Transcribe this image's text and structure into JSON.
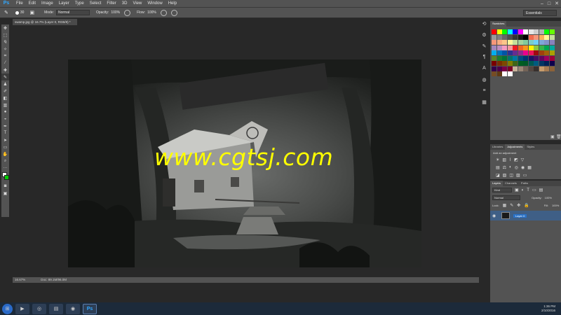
{
  "app": {
    "logo": "Ps"
  },
  "menubar": {
    "items": [
      "File",
      "Edit",
      "Image",
      "Layer",
      "Type",
      "Select",
      "Filter",
      "3D",
      "View",
      "Window",
      "Help"
    ]
  },
  "options_bar": {
    "brush_size": "30",
    "mode_label": "Mode:",
    "mode_value": "Normal",
    "opacity_label": "Opacity:",
    "opacity_value": "100%",
    "flow_label": "Flow:",
    "flow_value": "100%",
    "workspace": "Essentials"
  },
  "document": {
    "tab_title": "swamp.jpg @ 16.7% (Layer 0, RGB/8) *",
    "zoom": "16.67%",
    "doc_size": "Doc: 89.1M/96.0M"
  },
  "watermark": "www.cgtsj.com",
  "panels": {
    "swatches_title": "Swatches",
    "adjust_tabs": [
      "Libraries",
      "Adjustments",
      "Styles"
    ],
    "adjust_active": "Adjustments",
    "adjust_hint": "Add an adjustment",
    "layers_tabs": [
      "Layers",
      "Channels",
      "Paths"
    ],
    "layers_active": "Layers",
    "kind_label": "Kind",
    "blend_mode": "Normal",
    "opacity_label": "Opacity:",
    "opacity_value": "100%",
    "lock_label": "Lock:",
    "fill_label": "Fill:",
    "fill_value": "100%",
    "layer_name": "Layer 0"
  },
  "swatch_colors": [
    "#ff0000",
    "#ffff00",
    "#00ff00",
    "#00ffff",
    "#0000ff",
    "#ff00ff",
    "#ffffff",
    "#e6e6e6",
    "#cccccc",
    "#b3b3b3",
    "#00ff00",
    "#66ff00",
    "#999999",
    "#808080",
    "#666666",
    "#4d4d4d",
    "#333333",
    "#1a1a1a",
    "#000000",
    "#f26c4f",
    "#f69679",
    "#fbaf5d",
    "#fff799",
    "#c4df9b",
    "#f7977a",
    "#f9ad81",
    "#fdc68a",
    "#fff79a",
    "#c4df9b",
    "#a3d39c",
    "#82ca9d",
    "#7bcdc8",
    "#6ecff6",
    "#7ea7d8",
    "#8493ca",
    "#8882be",
    "#a187be",
    "#bc8dbf",
    "#f49ac2",
    "#f6989d",
    "#ed1c24",
    "#f26522",
    "#f7941d",
    "#fff200",
    "#8dc63f",
    "#39b54a",
    "#00a651",
    "#00a99d",
    "#00aeef",
    "#0072bc",
    "#0054a6",
    "#2e3192",
    "#662d91",
    "#92278f",
    "#ec008c",
    "#ed145b",
    "#9e0b0f",
    "#a0410d",
    "#a36209",
    "#aba000",
    "#598527",
    "#1a7b30",
    "#007236",
    "#00746b",
    "#0076a3",
    "#004b80",
    "#003471",
    "#1b1464",
    "#440e62",
    "#630460",
    "#9e005d",
    "#9e0039",
    "#790000",
    "#7b2e00",
    "#7d4900",
    "#827b00",
    "#406618",
    "#005e20",
    "#005826",
    "#005952",
    "#005b7f",
    "#003663",
    "#002157",
    "#0d004c",
    "#32004b",
    "#4b0049",
    "#7b0046",
    "#7a0026",
    "#c7b299",
    "#998675",
    "#736357",
    "#534741",
    "#37302d",
    "#c69c6d",
    "#a67c52",
    "#8c6239",
    "#754c24",
    "#603913",
    "#ffffff",
    "#ffffff"
  ],
  "taskbar": {
    "time": "1:36 PM",
    "date": "2/10/2016"
  }
}
